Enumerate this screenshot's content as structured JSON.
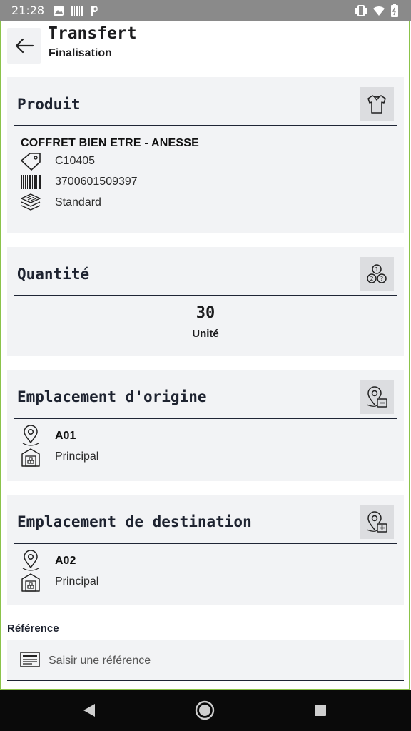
{
  "status_bar": {
    "time": "21:28"
  },
  "header": {
    "title": "Transfert",
    "subtitle": "Finalisation"
  },
  "product": {
    "section_title": "Produit",
    "name": "COFFRET BIEN ETRE - ANESSE",
    "reference": "C10405",
    "barcode": "3700601509397",
    "variant": "Standard"
  },
  "quantity": {
    "section_title": "Quantité",
    "value": "30",
    "unit": "Unité"
  },
  "origin": {
    "section_title": "Emplacement d'origine",
    "location": "A01",
    "warehouse": "Principal"
  },
  "destination": {
    "section_title": "Emplacement de destination",
    "location": "A02",
    "warehouse": "Principal"
  },
  "reference_field": {
    "label": "Référence",
    "placeholder": "Saisir une référence"
  }
}
